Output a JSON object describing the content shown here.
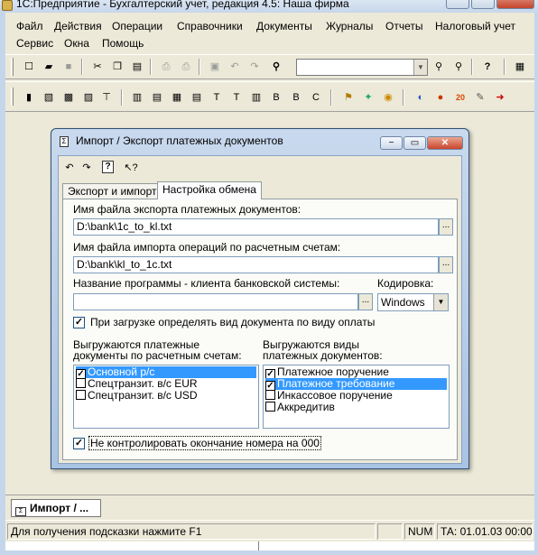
{
  "window": {
    "title": "1С:Предприятие - Бухгалтерский учет, редакция 4.5: Наша фирма"
  },
  "menu": [
    "Файл",
    "Действия",
    "Операции",
    "Справочники",
    "Документы",
    "Журналы",
    "Отчеты",
    "Налоговый учет",
    "Сервис",
    "Окна",
    "Помощь"
  ],
  "toolbar1": {
    "icons": [
      "new-icon",
      "open-icon",
      "save-icon",
      "cut-icon",
      "copy-icon",
      "paste-icon",
      "print-icon",
      "print-preview-icon",
      "properties-icon",
      "undo-icon",
      "redo-icon",
      "find-icon",
      "find-next-icon",
      "find-prev-icon",
      "help-icon",
      "calculator-icon"
    ],
    "search_value": ""
  },
  "dialog": {
    "title": "Импорт / Экспорт платежных документов",
    "tabs": [
      "Экспорт и импорт",
      "Настройка обмена"
    ],
    "active_tab": "Настройка обмена",
    "export_file_label": "Имя файла экспорта платежных документов:",
    "export_file_value": "D:\\bank\\1c_to_kl.txt",
    "import_file_label": "Имя файла импорта операций по расчетным счетам:",
    "import_file_value": "D:\\bank\\kl_to_1c.txt",
    "program_label": "Название программы - клиента банковской системы:",
    "program_value": "",
    "encoding_label": "Кодировка:",
    "encoding_value": "Windows",
    "detect_type_label": "При загрузке определять вид документа по виду оплаты",
    "detect_type_checked": true,
    "accounts_label_1": "Выгружаются платежные",
    "accounts_label_2": "документы по расчетным счетам:",
    "accounts": [
      {
        "label": "Основной р/с",
        "checked": true,
        "selected": true
      },
      {
        "label": "Спецтранзит. в/с EUR",
        "checked": false,
        "selected": false
      },
      {
        "label": "Спецтранзит. в/с USD",
        "checked": false,
        "selected": false
      }
    ],
    "doc_types_label_1": "Выгружаются виды",
    "doc_types_label_2": "платежных документов:",
    "doc_types": [
      {
        "label": "Платежное поручение",
        "checked": true,
        "selected": false
      },
      {
        "label": "Платежное требование",
        "checked": true,
        "selected": true
      },
      {
        "label": "Инкассовое поручение",
        "checked": false,
        "selected": false
      },
      {
        "label": "Аккредитив",
        "checked": false,
        "selected": false
      }
    ],
    "no_control_label": "Не контролировать окончание номера на 000",
    "no_control_checked": true
  },
  "taskbar": {
    "item": "Импорт / ..."
  },
  "status": {
    "hint": "Для получения подсказки нажмите F1",
    "num": "NUM",
    "ta": "ТА: 01.01.03  00:00:00"
  },
  "colors": {
    "selection": "#3399ff",
    "chrome": "#ece9d8",
    "frame": "#c6d6ea"
  }
}
